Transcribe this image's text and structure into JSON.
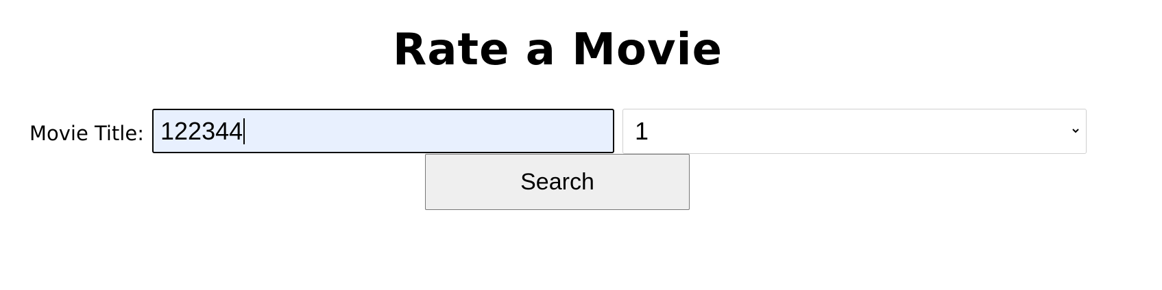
{
  "page": {
    "title": "Rate a Movie"
  },
  "form": {
    "title_label": "Movie Title:",
    "title_value": "122344",
    "rating_selected": "1",
    "search_label": "Search"
  },
  "icons": {
    "select_arrow": "chevron-down-icon"
  }
}
